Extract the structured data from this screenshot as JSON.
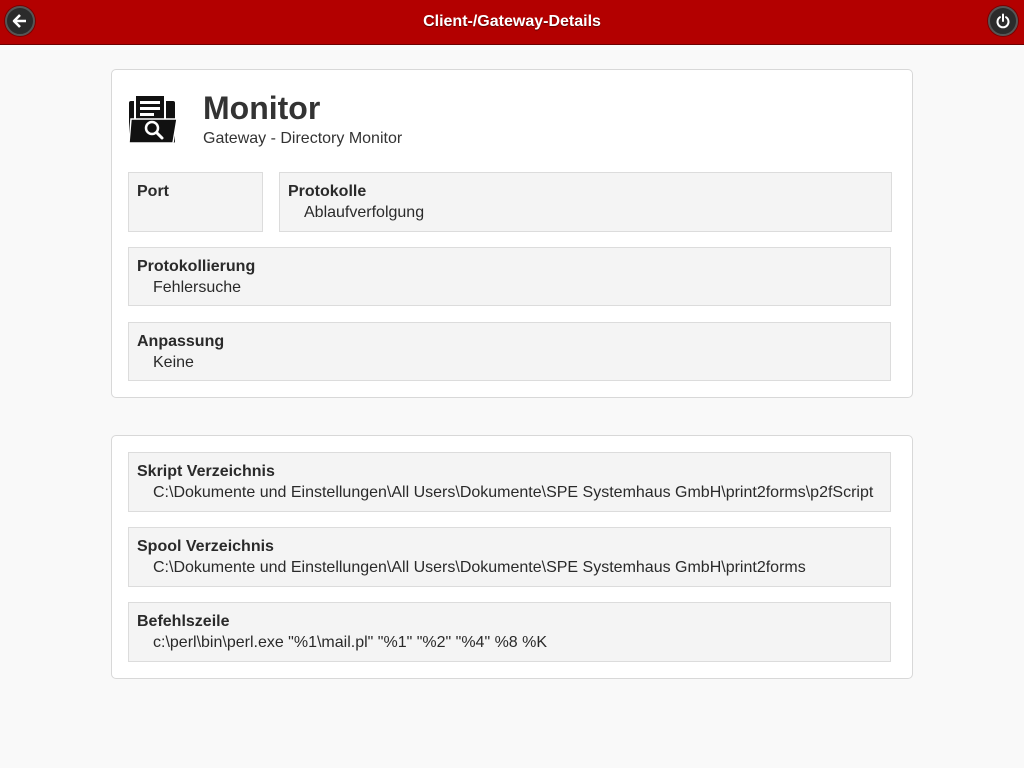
{
  "header": {
    "title": "Client-/Gateway-Details",
    "back_icon": "arrow-left-icon",
    "power_icon": "power-icon"
  },
  "colors": {
    "header_background": "#b30000",
    "page_background": "#f9f9f9",
    "field_background": "#f4f4f4"
  },
  "details": {
    "icon": "document-search-icon",
    "name": "Monitor",
    "subtitle": "Gateway - Directory Monitor",
    "port": {
      "label": "Port",
      "value": ""
    },
    "protokolle": {
      "label": "Protokolle",
      "value": "Ablaufverfolgung"
    },
    "protokollierung": {
      "label": "Protokollierung",
      "value": "Fehlersuche"
    },
    "anpassung": {
      "label": "Anpassung",
      "value": "Keine"
    }
  },
  "paths": {
    "skript": {
      "label": "Skript Verzeichnis",
      "value": "C:\\Dokumente und Einstellungen\\All Users\\Dokumente\\SPE Systemhaus GmbH\\print2forms\\p2fScript"
    },
    "spool": {
      "label": "Spool Verzeichnis",
      "value": "C:\\Dokumente und Einstellungen\\All Users\\Dokumente\\SPE Systemhaus GmbH\\print2forms"
    },
    "befehlszeile": {
      "label": "Befehlszeile",
      "value": "c:\\perl\\bin\\perl.exe \"%1\\mail.pl\" \"%1\" \"%2\" \"%4\" %8 %K"
    }
  }
}
